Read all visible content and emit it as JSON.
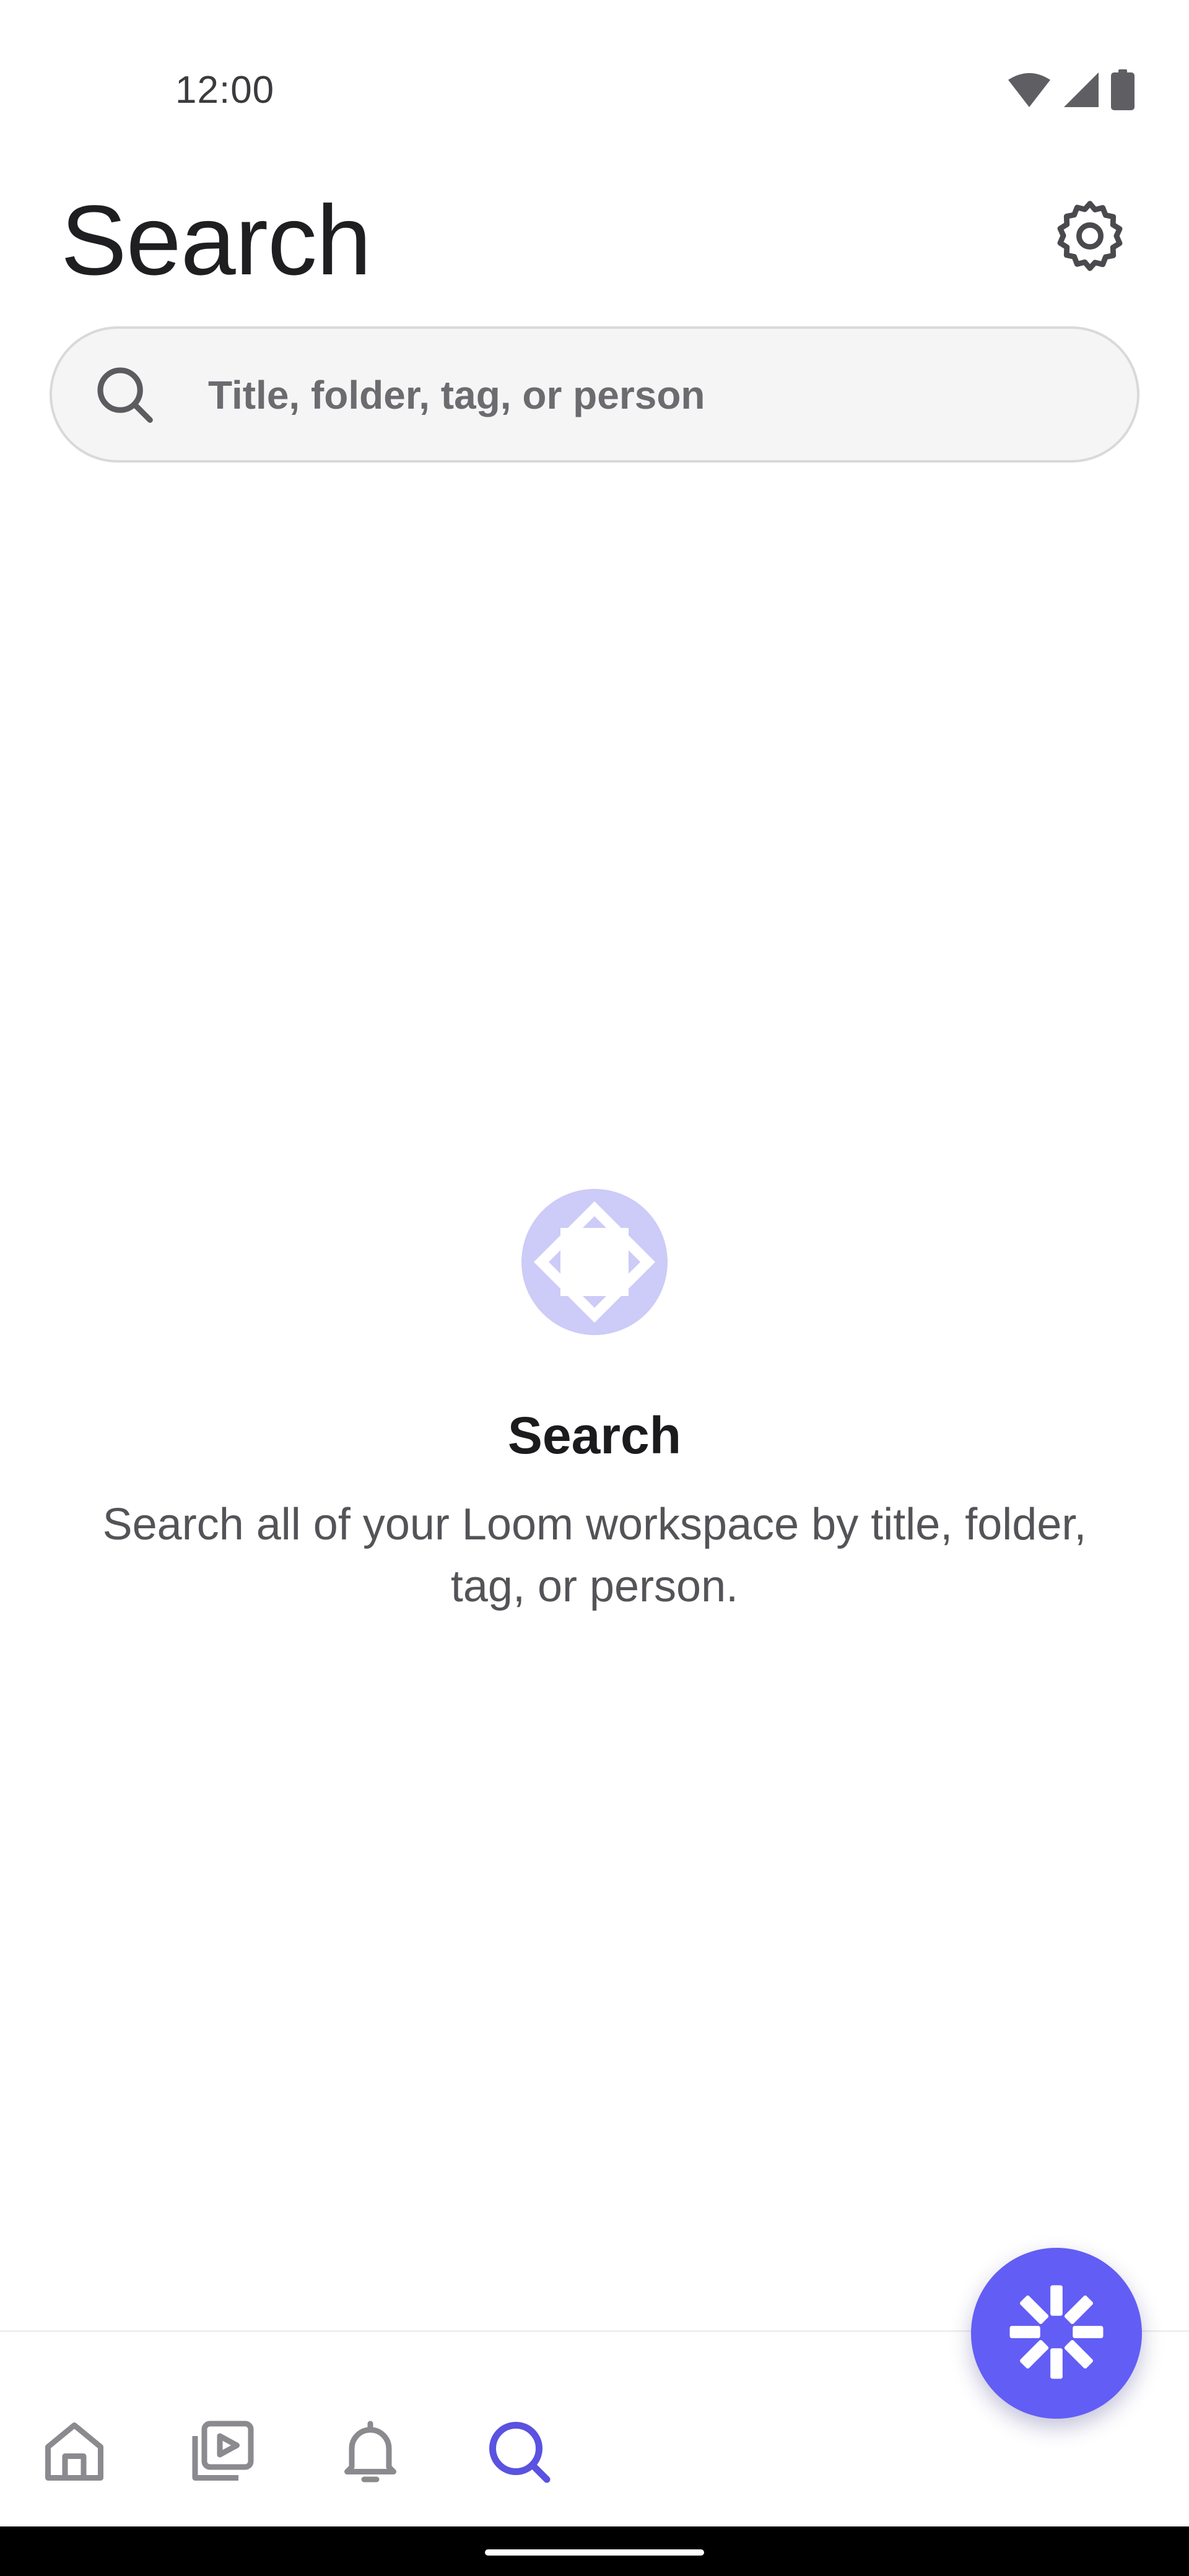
{
  "status_bar": {
    "time": "12:00",
    "icons": [
      "wifi-icon",
      "signal-icon",
      "battery-icon"
    ]
  },
  "header": {
    "title": "Search",
    "settings_icon": "gear-icon"
  },
  "search": {
    "placeholder": "Title, folder, tag, or person",
    "value": "",
    "icon": "search-icon"
  },
  "empty_state": {
    "illustration": "loom-search-illustration",
    "title": "Search",
    "description": "Search all of your Loom workspace by title, folder, tag, or person."
  },
  "bottom_nav": {
    "items": [
      {
        "icon": "home-icon",
        "active": false
      },
      {
        "icon": "video-library-icon",
        "active": false
      },
      {
        "icon": "bell-icon",
        "active": false
      },
      {
        "icon": "search-icon",
        "active": true
      }
    ]
  },
  "fab": {
    "icon": "loom-record-icon"
  },
  "colors": {
    "accent": "#625DF5",
    "illustration": "#CDCBF7",
    "nav_inactive": "#8A8A8F",
    "nav_active": "#5A52E0"
  }
}
